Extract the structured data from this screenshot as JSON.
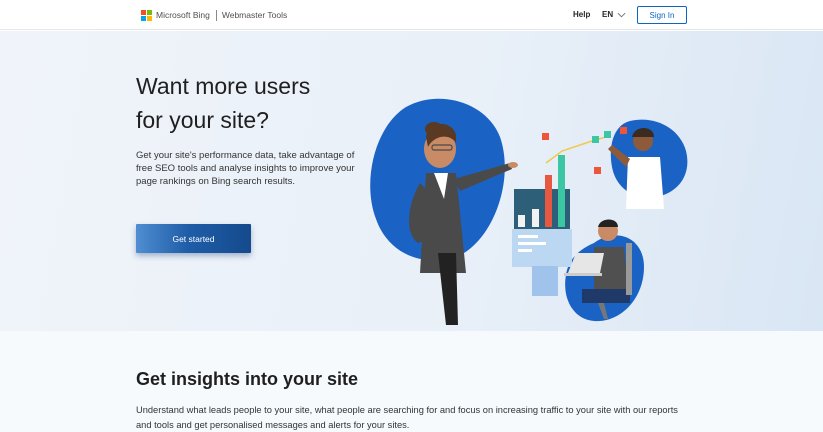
{
  "header": {
    "brand": "Microsoft Bing",
    "product": "Webmaster Tools",
    "help": "Help",
    "language": "EN",
    "signin": "Sign In",
    "logo_colors": [
      "#f25022",
      "#7fba00",
      "#00a4ef",
      "#ffb900"
    ],
    "accent": "#0a66c2"
  },
  "hero": {
    "title_line1": "Want more users",
    "title_line2": "for your site?",
    "description": "Get your site's performance data, take advantage of free SEO tools and analyse insights to improve your page rankings on Bing search results.",
    "cta": "Get started"
  },
  "insights": {
    "title": "Get insights into your site",
    "description": "Understand what leads people to your site, what people are searching for and focus on increasing traffic to your site with our reports and tools and get personalised messages and alerts for your sites."
  },
  "icons": {
    "logo": "microsoft-logo-icon",
    "language_chevron": "chevron-down-icon"
  }
}
